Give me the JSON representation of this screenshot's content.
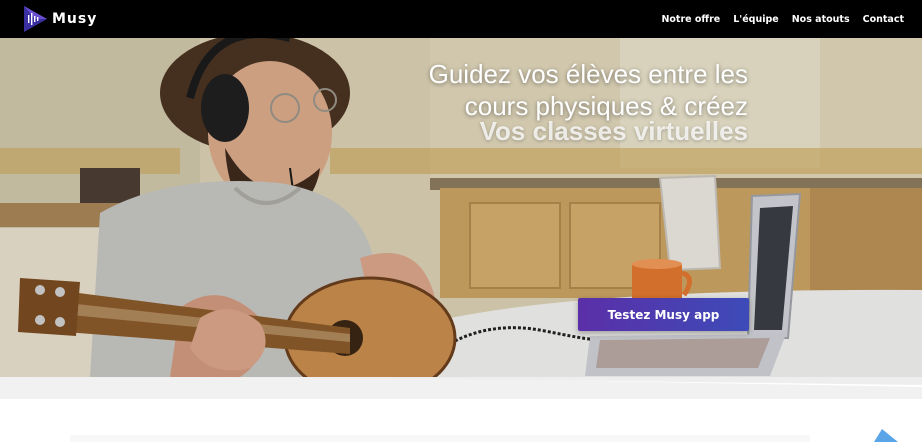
{
  "navbar": {
    "brand": "Musy",
    "links": [
      "Notre offre",
      "L'équipe",
      "Nos atouts",
      "Contact"
    ]
  },
  "hero": {
    "title": "Guidez vos élèves entre les cours physiques & créez",
    "subtitle": "Vos classes virtuelles",
    "cta": "Testez Musy app"
  },
  "colors": {
    "navbar_bg": "#000000",
    "cta_start": "#5b2fa8",
    "cta_end": "#3d4bb8",
    "logo_accent": "#3a2fa0"
  },
  "icons": {
    "logo": "musy-logo-icon",
    "corner_shape": "blue-triangle-icon"
  }
}
